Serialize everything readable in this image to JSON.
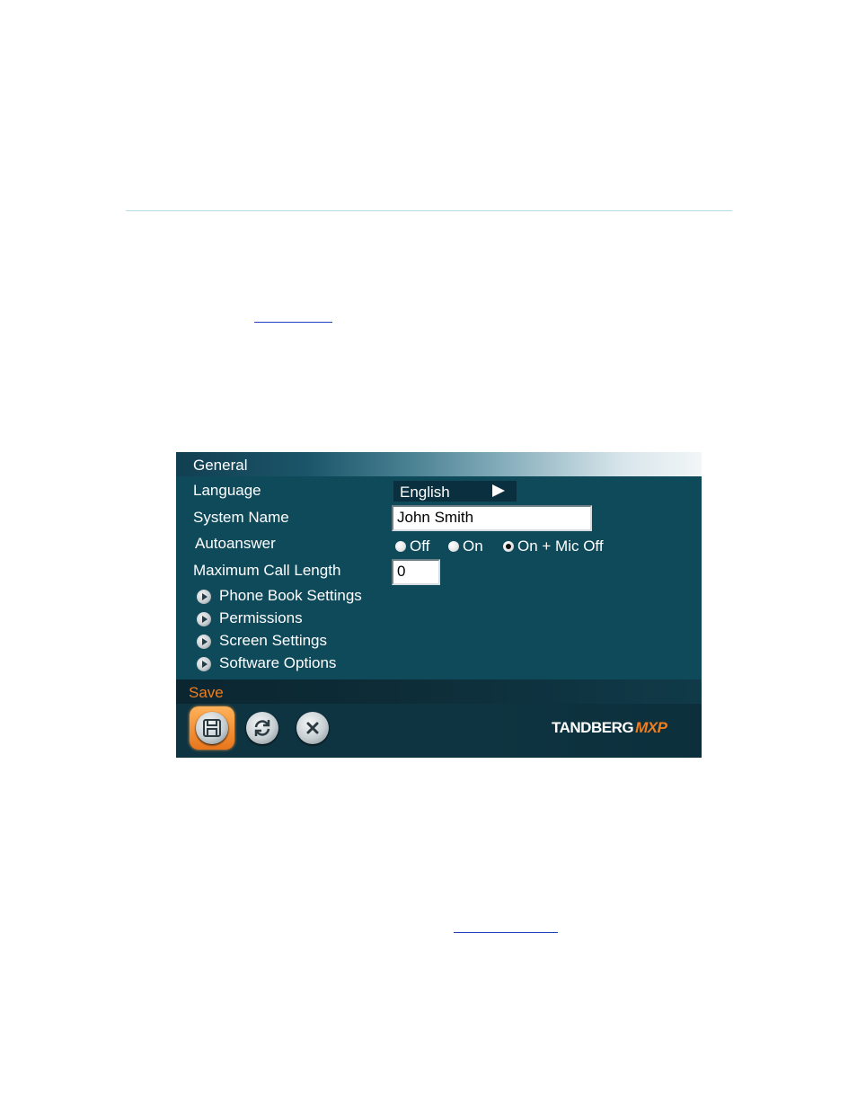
{
  "panel": {
    "title": "General",
    "fields": {
      "language": {
        "label": "Language",
        "value": "English"
      },
      "system_name": {
        "label": "System Name",
        "value": "John Smith"
      },
      "autoanswer": {
        "label": "Autoanswer",
        "options": [
          "Off",
          "On",
          "On + Mic Off"
        ],
        "selected": "On + Mic Off"
      },
      "max_call_length": {
        "label": "Maximum Call Length",
        "value": "0"
      }
    },
    "menu_items": [
      {
        "label": "Phone Book Settings"
      },
      {
        "label": "Permissions"
      },
      {
        "label": "Screen Settings"
      },
      {
        "label": "Software Options"
      }
    ],
    "status": "Save",
    "toolbar": {
      "icons": [
        "floppy-disk-icon",
        "refresh-icon",
        "close-icon"
      ],
      "brand": "TANDBERG",
      "brand_sub": "MXP"
    }
  },
  "colors": {
    "panel_bg": "#0f4a5b",
    "accent": "#f07d1e",
    "rule": "#b9dbe8"
  }
}
